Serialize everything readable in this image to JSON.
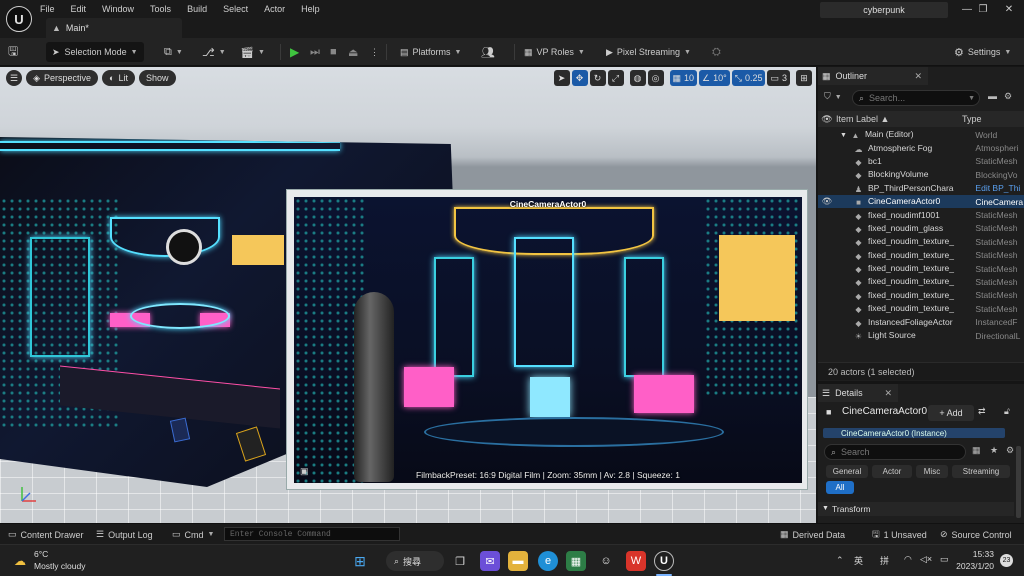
{
  "app": {
    "logo": "U",
    "project": "cyberpunk"
  },
  "menu": [
    "File",
    "Edit",
    "Window",
    "Tools",
    "Build",
    "Select",
    "Actor",
    "Help"
  ],
  "tab": {
    "label": "Main*"
  },
  "window_controls": {
    "minimize": "—",
    "maximize": "❐",
    "close": "✕"
  },
  "toolbar": {
    "selection_mode": "Selection Mode",
    "platforms": "Platforms",
    "vp_roles": "VP Roles",
    "pixel_streaming": "Pixel Streaming",
    "settings": "Settings"
  },
  "viewport": {
    "perspective": "Perspective",
    "lit": "Lit",
    "show": "Show",
    "grid_snap": "10",
    "rot_snap": "10°",
    "scale_snap": "0.25",
    "cam_speed": "3",
    "camera_label": "CineCameraActor0",
    "filmback": "FilmbackPreset: 16:9 Digital Film | Zoom: 35mm | Av: 2.8 | Squeeze: 1"
  },
  "outliner": {
    "title": "Outliner",
    "search_placeholder": "Search...",
    "col_label": "Item Label ▲",
    "col_type": "Type",
    "rows": [
      {
        "label": "Main (Editor)",
        "type": "World",
        "indent": 1,
        "icon": "▲"
      },
      {
        "label": "Atmospheric Fog",
        "type": "Atmospheri",
        "indent": 2,
        "icon": "☁"
      },
      {
        "label": "bc1",
        "type": "StaticMesh",
        "indent": 2,
        "icon": "◆"
      },
      {
        "label": "BlockingVolume",
        "type": "BlockingVo",
        "indent": 2,
        "icon": "◆"
      },
      {
        "label": "BP_ThirdPersonChara",
        "type": "Edit BP_Thi",
        "indent": 2,
        "icon": "♟"
      },
      {
        "label": "CineCameraActor0",
        "type": "CineCamera",
        "indent": 2,
        "icon": "■",
        "selected": true
      },
      {
        "label": "fixed_noudimf1001",
        "type": "StaticMesh",
        "indent": 2,
        "icon": "◆"
      },
      {
        "label": "fixed_noudim_glass",
        "type": "StaticMesh",
        "indent": 2,
        "icon": "◆"
      },
      {
        "label": "fixed_noudim_texture_",
        "type": "StaticMesh",
        "indent": 2,
        "icon": "◆"
      },
      {
        "label": "fixed_noudim_texture_",
        "type": "StaticMesh",
        "indent": 2,
        "icon": "◆"
      },
      {
        "label": "fixed_noudim_texture_",
        "type": "StaticMesh",
        "indent": 2,
        "icon": "◆"
      },
      {
        "label": "fixed_noudim_texture_",
        "type": "StaticMesh",
        "indent": 2,
        "icon": "◆"
      },
      {
        "label": "fixed_noudim_texture_",
        "type": "StaticMesh",
        "indent": 2,
        "icon": "◆"
      },
      {
        "label": "fixed_noudim_texture_",
        "type": "StaticMesh",
        "indent": 2,
        "icon": "◆"
      },
      {
        "label": "InstancedFoliageActor",
        "type": "InstancedF",
        "indent": 2,
        "icon": "◆"
      },
      {
        "label": "Light Source",
        "type": "DirectionalL",
        "indent": 2,
        "icon": "☀"
      }
    ],
    "count": "20 actors (1 selected)"
  },
  "details": {
    "title": "Details",
    "actor_name": "CineCameraActor0",
    "add": "+ Add",
    "component": "CineCameraActor0 (Instance)",
    "search_placeholder": "Search",
    "filters": [
      "General",
      "Actor",
      "Misc",
      "Streaming"
    ],
    "filter_all": "All",
    "section": "Transform"
  },
  "statusbar": {
    "content_drawer": "Content Drawer",
    "output_log": "Output Log",
    "cmd": "Cmd",
    "console_placeholder": "Enter Console Command",
    "derived_data": "Derived Data",
    "unsaved": "1 Unsaved",
    "source_control": "Source Control"
  },
  "taskbar": {
    "temp": "6°C",
    "weather": "Mostly cloudy",
    "search": "搜尋",
    "ime1": "英",
    "ime2": "拼",
    "time": "15:33",
    "date": "2023/1/20",
    "notifications": "23"
  }
}
